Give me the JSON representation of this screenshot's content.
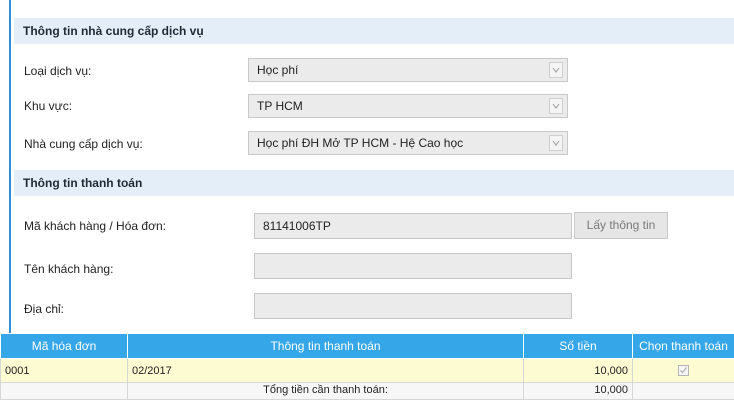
{
  "provider_section": {
    "title": "Thông tin nhà cung cấp dịch vụ",
    "fields": [
      {
        "label": "Loại dịch vụ:",
        "value": "Học phí"
      },
      {
        "label": "Khu vực:",
        "value": "TP HCM"
      },
      {
        "label": "Nhà cung cấp dịch vụ:",
        "value": "Học phí ĐH Mở TP HCM - Hệ Cao học"
      }
    ]
  },
  "payment_section": {
    "title": "Thông tin thanh toán",
    "customer_code_label": "Mã khách hàng / Hóa đơn:",
    "customer_code_value": "81141006TP",
    "get_info_button": "Lấy thông tin",
    "customer_name_label": "Tên khách hàng:",
    "customer_name_value": "",
    "address_label": "Địa chỉ:",
    "address_value": ""
  },
  "invoice_table": {
    "columns": [
      "Mã hóa đơn",
      "Thông tin thanh toán",
      "Số tiền",
      "Chọn thanh toán"
    ],
    "rows": [
      {
        "code": "0001",
        "info": "02/2017",
        "amount": "10,000",
        "selected": true
      }
    ],
    "total_label": "Tổng tiền cần thanh toán:",
    "total_value": "10,000"
  },
  "colors": {
    "accent": "#2e8fd6",
    "header_bg": "#35a6e8",
    "section_bg": "#e4eef8",
    "row_highlight": "#fdfbd2"
  }
}
